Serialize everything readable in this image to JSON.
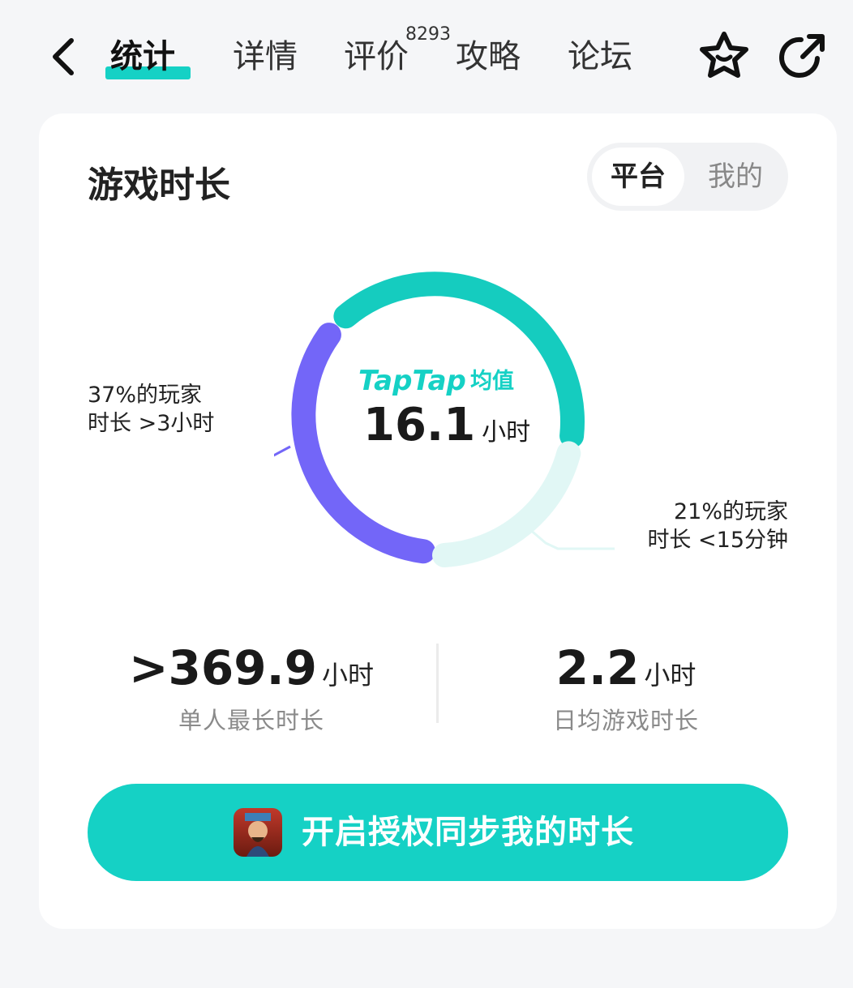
{
  "nav": {
    "tabs": [
      {
        "label": "统计"
      },
      {
        "label": "详情"
      },
      {
        "label": "评价"
      },
      {
        "label": "攻略"
      },
      {
        "label": "论坛"
      }
    ],
    "review_count": "8293",
    "active_color": "#15d1c5"
  },
  "card": {
    "title": "游戏时长",
    "segments": {
      "platform": "平台",
      "mine": "我的"
    },
    "center": {
      "brand": "TapTap",
      "brand_suffix": "均值",
      "value": "16.1",
      "unit": "小时"
    },
    "donut": {
      "segments": [
        {
          "label": "37%的玩家 时长 >3小时",
          "percent": 37,
          "color": "#7366f8"
        },
        {
          "label": "42%",
          "percent": 42,
          "color": "#15ccbf"
        },
        {
          "label": "21%的玩家 时长 <15分钟",
          "percent": 21,
          "color": "#e1f7f5"
        }
      ]
    },
    "left_label": {
      "line1": "37%的玩家",
      "line2": "时长 >3小时"
    },
    "right_label": {
      "line1": "21%的玩家",
      "line2": "时长 <15分钟"
    },
    "stats": [
      {
        "value": ">369.9",
        "unit": "小时",
        "label": "单人最长时长"
      },
      {
        "value": "2.2",
        "unit": "小时",
        "label": "日均游戏时长"
      }
    ],
    "sync_button": {
      "label": "开启授权同步我的时长"
    }
  }
}
